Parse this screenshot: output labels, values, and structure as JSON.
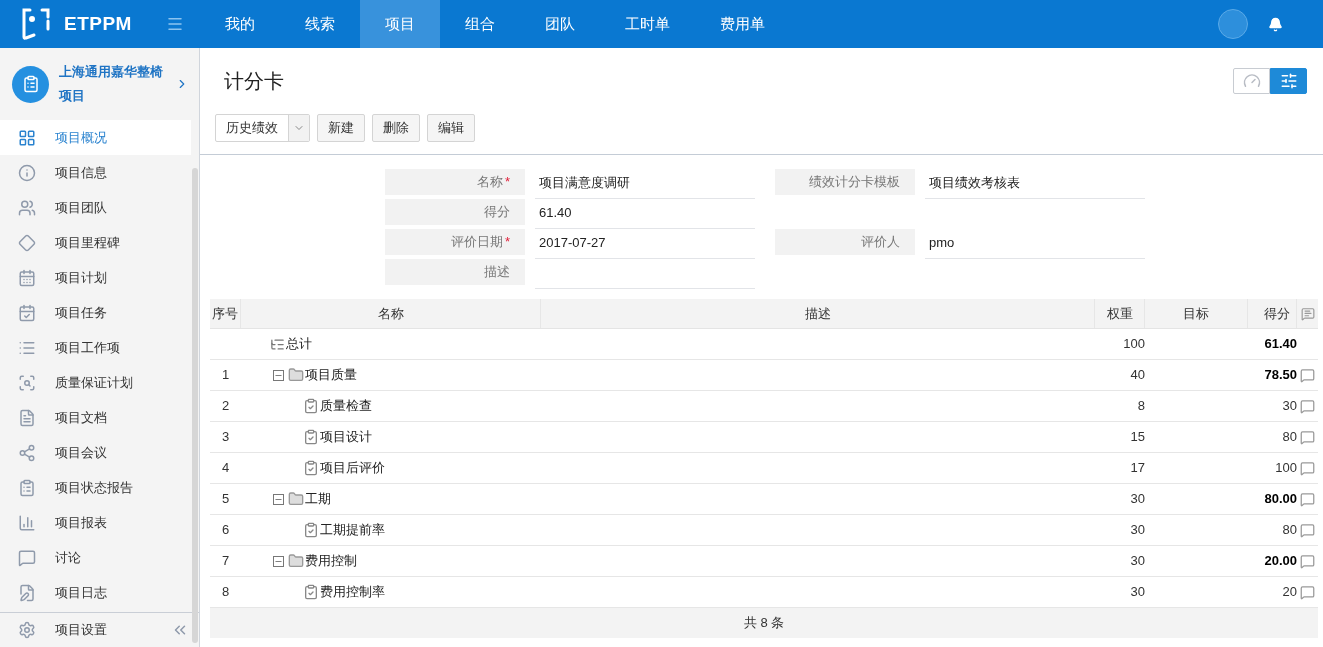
{
  "topbar": {
    "brand": "ETPPM",
    "tabs": [
      {
        "label": "我的",
        "selected": false
      },
      {
        "label": "线索",
        "selected": false
      },
      {
        "label": "项目",
        "selected": true
      },
      {
        "label": "组合",
        "selected": false
      },
      {
        "label": "团队",
        "selected": false
      },
      {
        "label": "工时单",
        "selected": false
      },
      {
        "label": "费用单",
        "selected": false
      }
    ]
  },
  "sidebar": {
    "project": "上海通用嘉华整椅项目",
    "items": [
      {
        "label": "项目概况",
        "selected": true
      },
      {
        "label": "项目信息",
        "selected": false
      },
      {
        "label": "项目团队",
        "selected": false
      },
      {
        "label": "项目里程碑",
        "selected": false
      },
      {
        "label": "项目计划",
        "selected": false
      },
      {
        "label": "项目任务",
        "selected": false
      },
      {
        "label": "项目工作项",
        "selected": false
      },
      {
        "label": "质量保证计划",
        "selected": false
      },
      {
        "label": "项目文档",
        "selected": false
      },
      {
        "label": "项目会议",
        "selected": false
      },
      {
        "label": "项目状态报告",
        "selected": false
      },
      {
        "label": "项目报表",
        "selected": false
      },
      {
        "label": "讨论",
        "selected": false
      },
      {
        "label": "项目日志",
        "selected": false
      }
    ],
    "footer": "项目设置"
  },
  "page": {
    "title": "计分卡",
    "views": [
      {
        "kind": "gauge",
        "selected": false
      },
      {
        "kind": "list",
        "selected": true
      }
    ],
    "toolbar": {
      "dropdown": "历史绩效",
      "buttons": [
        "新建",
        "删除",
        "编辑"
      ]
    }
  },
  "form": {
    "rows": [
      [
        {
          "label": "名称",
          "required_mark": "*",
          "value": "项目满意度调研"
        },
        {
          "label": "绩效计分卡模板",
          "value": "项目绩效考核表"
        }
      ],
      [
        {
          "label": "得分",
          "value": "61.40"
        }
      ],
      [
        {
          "label": "评价日期",
          "required_mark": "*",
          "value": "2017-07-27"
        },
        {
          "label": "评价人",
          "value": "pmo"
        }
      ],
      [
        {
          "label": "描述"
        }
      ]
    ]
  },
  "table": {
    "columns": [
      "序号",
      "名称",
      "描述",
      "权重",
      "目标",
      "得分"
    ],
    "rows": [
      {
        "kind": "total",
        "name": "总计",
        "weight": "100",
        "score": "61.40"
      },
      {
        "kind": "group",
        "index": "1",
        "name": "项目质量",
        "weight": "40",
        "score": "78.50",
        "expanded": true,
        "children": [
          {
            "kind": "item",
            "index": "2",
            "name": "质量检查",
            "weight": "8",
            "score": "30"
          },
          {
            "kind": "item",
            "index": "3",
            "name": "项目设计",
            "weight": "15",
            "score": "80"
          },
          {
            "kind": "item",
            "index": "4",
            "name": "项目后评价",
            "weight": "17",
            "score": "100"
          }
        ]
      },
      {
        "kind": "group",
        "index": "5",
        "name": "工期",
        "weight": "30",
        "score": "80.00",
        "expanded": true,
        "children": [
          {
            "kind": "item",
            "index": "6",
            "name": "工期提前率",
            "weight": "30",
            "score": "80"
          }
        ]
      },
      {
        "kind": "group",
        "index": "7",
        "name": "费用控制",
        "weight": "30",
        "score": "20.00",
        "expanded": true,
        "children": [
          {
            "kind": "item",
            "index": "8",
            "name": "费用控制率",
            "weight": "30",
            "score": "20"
          }
        ]
      }
    ],
    "footer": "共 8 条"
  }
}
